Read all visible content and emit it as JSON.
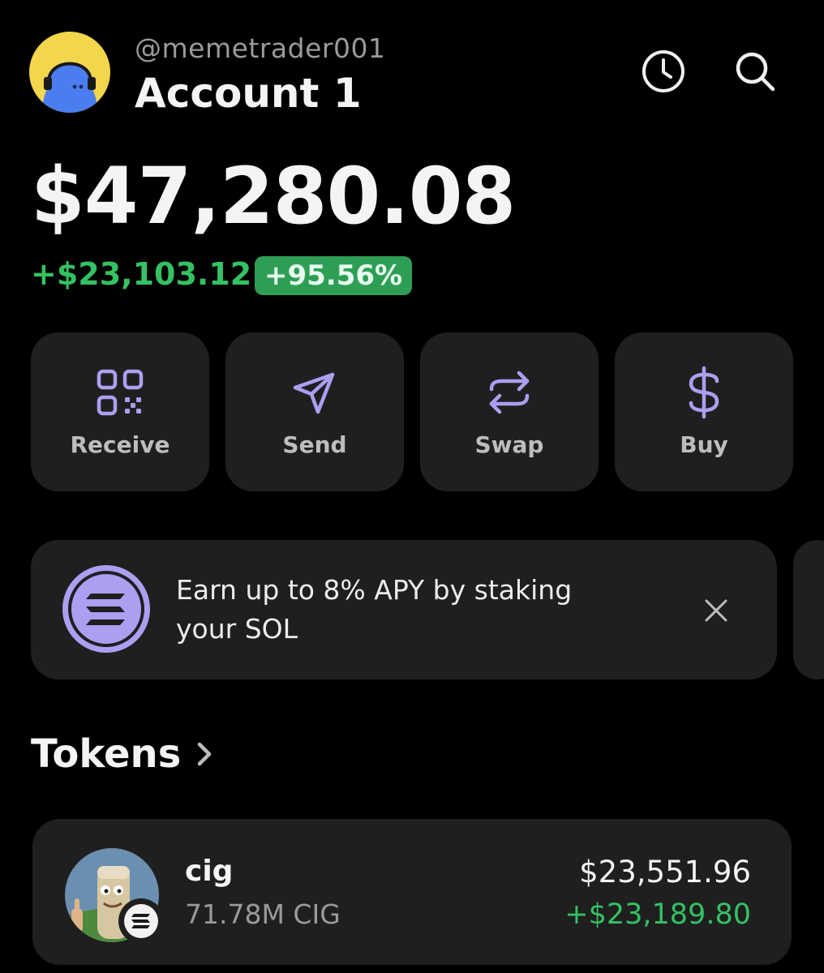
{
  "header": {
    "username": "@memetrader001",
    "account_name": "Account 1",
    "avatar_icon": "ghost-with-headphones",
    "history_icon": "clock-icon",
    "search_icon": "search-icon"
  },
  "balance": {
    "total": "$47,280.08",
    "change_amount": "+$23,103.12",
    "change_percent": "+95.56%"
  },
  "actions": [
    {
      "label": "Receive",
      "icon": "qr-code-icon"
    },
    {
      "label": "Send",
      "icon": "send-icon"
    },
    {
      "label": "Swap",
      "icon": "swap-icon"
    },
    {
      "label": "Buy",
      "icon": "dollar-icon"
    }
  ],
  "banner": {
    "text": "Earn up to 8% APY by staking your SOL",
    "icon": "solana-icon",
    "close_icon": "close-icon"
  },
  "tokens": {
    "title": "Tokens",
    "items": [
      {
        "name": "cig",
        "quantity": "71.78M CIG",
        "value": "$23,551.96",
        "change": "+$23,189.80"
      }
    ]
  },
  "colors": {
    "background": "#000000",
    "card": "#1f1f1f",
    "accent_purple": "#ab9ff2",
    "positive_green": "#34c163",
    "badge_green": "#2f9e55"
  }
}
